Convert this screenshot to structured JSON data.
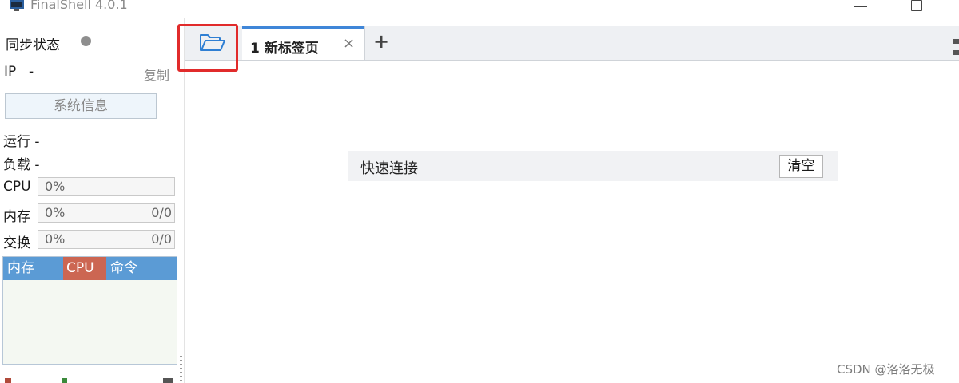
{
  "window": {
    "title": "FinalShell 4.0.1",
    "icon": "terminal-app-icon"
  },
  "sidebar": {
    "sync_label": "同步状态",
    "sync_status_color": "#8e8e8e",
    "ip_label": "IP",
    "ip_value": "-",
    "copy_label": "复制",
    "sysinfo_button": "系统信息",
    "uptime_label": "运行 -",
    "load_label": "负载 -",
    "cpu": {
      "label": "CPU",
      "percent": "0%"
    },
    "memory": {
      "label": "内存",
      "percent": "0%",
      "ratio": "0/0"
    },
    "swap": {
      "label": "交换",
      "percent": "0%",
      "ratio": "0/0"
    },
    "process_table": {
      "columns": [
        "内存",
        "CPU",
        "命令"
      ],
      "active_column_color": "#cc6652",
      "header_color": "#5b9bd5"
    }
  },
  "tabs": {
    "open_icon": "folder-open-icon",
    "items": [
      {
        "label": "1 新标签页",
        "active": true
      }
    ],
    "close_glyph": "×",
    "add_glyph": "+"
  },
  "quick_connect": {
    "label": "快速连接",
    "clear_button": "清空"
  },
  "watermark": "CSDN @洛洛无极",
  "colors": {
    "accent": "#3f86d8",
    "highlight": "#e12b2b"
  }
}
